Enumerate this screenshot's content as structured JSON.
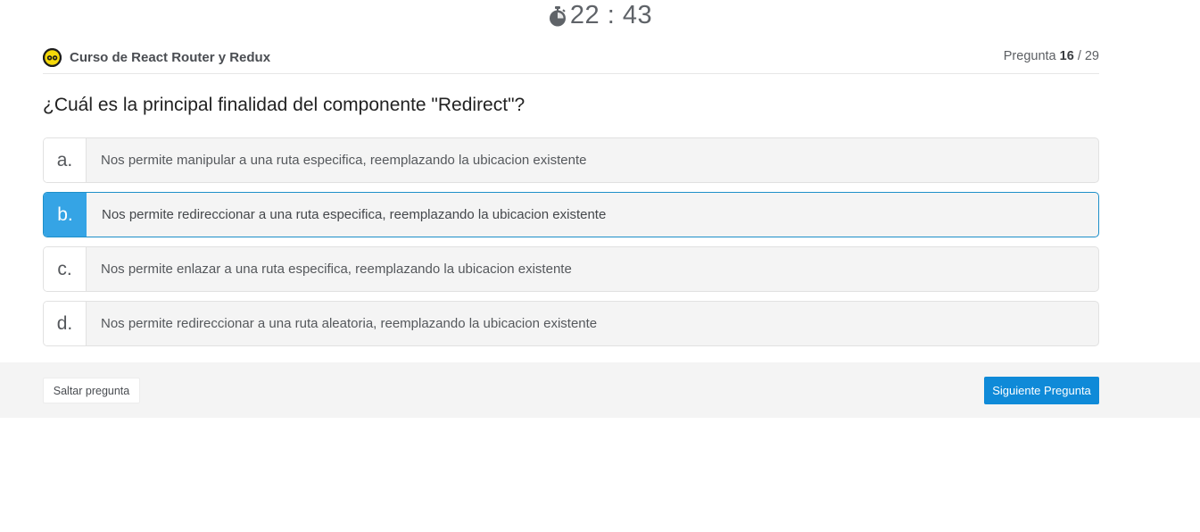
{
  "timer": {
    "icon": "stopwatch-icon",
    "time": "22 : 43"
  },
  "header": {
    "logo_icon": "course-logo-icon",
    "course_name": "Curso de React Router y Redux",
    "counter_prefix": "Pregunta",
    "current": "16",
    "separator": "/ 29"
  },
  "question": "¿Cuál es la principal finalidad del componente \"Redirect\"?",
  "options": [
    {
      "letter": "a.",
      "text": "Nos permite manipular a una ruta especifica, reemplazando la ubicacion existente"
    },
    {
      "letter": "b.",
      "text": "Nos permite redireccionar a una ruta especifica, reemplazando la ubicacion existente"
    },
    {
      "letter": "c.",
      "text": "Nos permite enlazar a una ruta especifica, reemplazando la ubicacion existente"
    },
    {
      "letter": "d.",
      "text": "Nos permite redireccionar a una ruta aleatoria, reemplazando la ubicacion existente"
    }
  ],
  "selected_option": "b.",
  "footer": {
    "skip_label": "Saltar pregunta",
    "next_label": "Siguiente Pregunta"
  },
  "colors": {
    "accent": "#0f8ad8",
    "selected": "#35a4e5",
    "logo": "#f5d90a"
  }
}
